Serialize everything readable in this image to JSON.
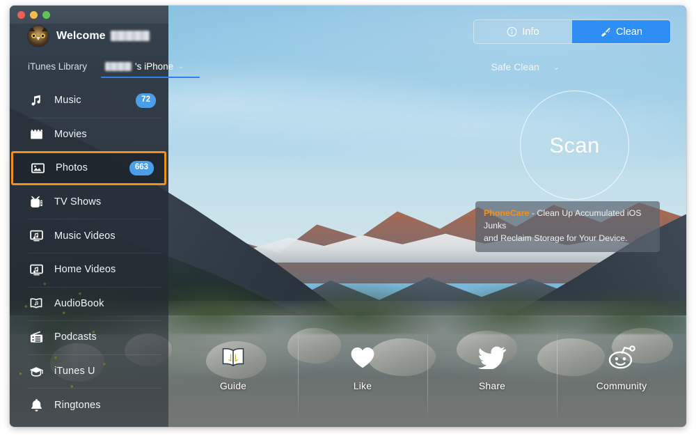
{
  "window": {
    "traffic_lights": [
      "close",
      "minimize",
      "zoom"
    ],
    "colors": {
      "close": "#ef5f56",
      "minimize": "#f4bd4f",
      "zoom": "#61c554",
      "accent_blue": "#2f8ef4",
      "badge_blue": "#4a9fe8",
      "highlight_orange": "#f2901e"
    }
  },
  "header": {
    "welcome_label": "Welcome",
    "username_redacted": true,
    "avatar_icon": "owl-avatar-icon"
  },
  "tabs": {
    "itunes_label": "iTunes Library",
    "device_suffix": "'s iPhone",
    "device_name_redacted": true,
    "device_chevron": "⌄",
    "active": "device"
  },
  "sidebar": {
    "items": [
      {
        "label": "Music",
        "icon": "music-note-icon",
        "badge": "72",
        "selected": false
      },
      {
        "label": "Movies",
        "icon": "clapperboard-icon",
        "badge": "",
        "selected": false
      },
      {
        "label": "Photos",
        "icon": "photo-icon",
        "badge": "663",
        "selected": true
      },
      {
        "label": "TV Shows",
        "icon": "television-icon",
        "badge": "",
        "selected": false
      },
      {
        "label": "Music Videos",
        "icon": "music-video-icon",
        "badge": "",
        "selected": false
      },
      {
        "label": "Home Videos",
        "icon": "home-video-icon",
        "badge": "",
        "selected": false
      },
      {
        "label": "AudioBook",
        "icon": "audiobook-icon",
        "badge": "",
        "selected": false
      },
      {
        "label": "Podcasts",
        "icon": "podcast-icon",
        "badge": "",
        "selected": false
      },
      {
        "label": "iTunes U",
        "icon": "graduation-cap-icon",
        "badge": "",
        "selected": false
      },
      {
        "label": "Ringtones",
        "icon": "bell-icon",
        "badge": "",
        "selected": false
      }
    ]
  },
  "toolbar": {
    "info_label": "Info",
    "info_icon": "info-circle-icon",
    "clean_label": "Clean",
    "clean_icon": "broom-icon",
    "active": "Clean"
  },
  "clean_mode": {
    "label": "Safe Clean",
    "chevron": "⌄"
  },
  "scan": {
    "label": "Scan"
  },
  "promo": {
    "brand": "PhoneCare",
    "line1_rest": " - Clean Up Accumulated iOS Junks",
    "line2": "and Reclaim Storage for Your Device."
  },
  "bottom_nav": {
    "items": [
      {
        "label": "Guide",
        "icon": "open-book-icon"
      },
      {
        "label": "Like",
        "icon": "heart-icon"
      },
      {
        "label": "Share",
        "icon": "twitter-bird-icon"
      },
      {
        "label": "Community",
        "icon": "reddit-alien-icon"
      }
    ]
  }
}
